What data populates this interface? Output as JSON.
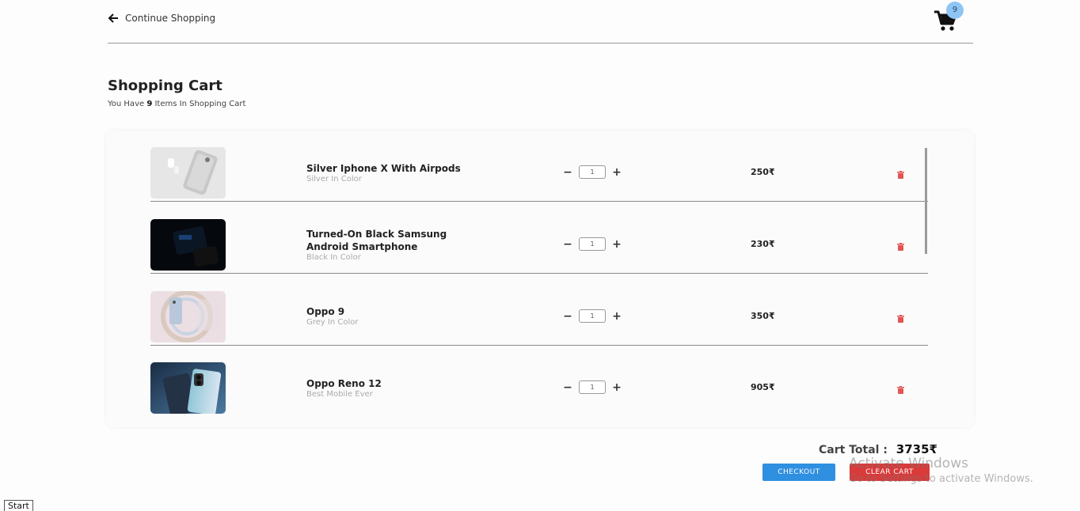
{
  "header": {
    "back_label": "Continue Shopping",
    "back_icon": "arrow-left-icon",
    "cart_icon": "shopping-cart-icon",
    "cart_badge": "9"
  },
  "cart": {
    "title": "Shopping Cart",
    "subtitle_prefix": "You Have",
    "item_count": "9",
    "subtitle_suffix": "Items In Shopping Cart",
    "items": [
      {
        "name": "Silver Iphone X With Airpods",
        "subtitle": "Silver In Color",
        "quantity": "1",
        "price": "250₹"
      },
      {
        "name": "Turned-On Black Samsung Android Smartphone",
        "subtitle": "Black In Color",
        "quantity": "1",
        "price": "230₹"
      },
      {
        "name": "Oppo 9",
        "subtitle": "Grey In Color",
        "quantity": "1",
        "price": "350₹"
      },
      {
        "name": "Oppo Reno 12",
        "subtitle": "Best Mobile Ever",
        "quantity": "1",
        "price": "905₹"
      }
    ],
    "minus_symbol": "−",
    "plus_symbol": "+",
    "delete_icon": "trash-icon"
  },
  "summary": {
    "total_label": "Cart Total :",
    "total_value": "3735₹",
    "checkout_label": "CHECKOUT",
    "clear_label": "CLEAR CART"
  },
  "overlay": {
    "activate_title": "Activate Windows",
    "activate_sub": "Go to Settings to activate Windows."
  },
  "taskbar": {
    "start_label": "Start"
  },
  "colors": {
    "checkout": "#2f8fe0",
    "clear": "#d93a3a",
    "badge": "#8ec5f5",
    "trash": "#e05555"
  }
}
